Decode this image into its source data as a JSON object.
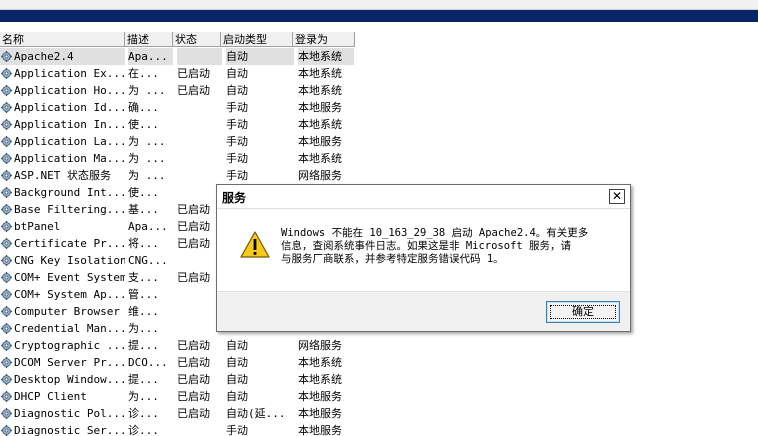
{
  "window": {
    "accent": "#0a246a"
  },
  "columns": {
    "name": "名称",
    "desc": "描述",
    "state": "状态",
    "startup": "启动类型",
    "logon": "登录为"
  },
  "services": [
    {
      "name": "Apache2.4",
      "desc": "Apa...",
      "state": "",
      "startup": "自动",
      "logon": "本地系统"
    },
    {
      "name": "Application Ex...",
      "desc": "在...",
      "state": "已启动",
      "startup": "自动",
      "logon": "本地系统"
    },
    {
      "name": "Application Ho...",
      "desc": "为 ...",
      "state": "已启动",
      "startup": "自动",
      "logon": "本地系统"
    },
    {
      "name": "Application Id...",
      "desc": "确...",
      "state": "",
      "startup": "手动",
      "logon": "本地服务"
    },
    {
      "name": "Application In...",
      "desc": "使...",
      "state": "",
      "startup": "手动",
      "logon": "本地系统"
    },
    {
      "name": "Application La...",
      "desc": "为 ...",
      "state": "",
      "startup": "手动",
      "logon": "本地服务"
    },
    {
      "name": "Application Ma...",
      "desc": "为 ...",
      "state": "",
      "startup": "手动",
      "logon": "本地系统"
    },
    {
      "name": "ASP.NET 状态服务",
      "desc": "为 ...",
      "state": "",
      "startup": "手动",
      "logon": "网络服务"
    },
    {
      "name": "Background Int...",
      "desc": "使...",
      "state": "",
      "startup": "",
      "logon": ""
    },
    {
      "name": "Base Filtering...",
      "desc": "基...",
      "state": "已启动",
      "startup": "",
      "logon": ""
    },
    {
      "name": "btPanel",
      "desc": "Apa...",
      "state": "已启动",
      "startup": "",
      "logon": ""
    },
    {
      "name": "Certificate Pr...",
      "desc": "将...",
      "state": "已启动",
      "startup": "",
      "logon": ""
    },
    {
      "name": "CNG Key Isolation",
      "desc": "CNG...",
      "state": "",
      "startup": "",
      "logon": ""
    },
    {
      "name": "COM+ Event System",
      "desc": "支...",
      "state": "已启动",
      "startup": "",
      "logon": ""
    },
    {
      "name": "COM+ System Ap...",
      "desc": "管...",
      "state": "",
      "startup": "",
      "logon": ""
    },
    {
      "name": "Computer Browser",
      "desc": "维...",
      "state": "",
      "startup": "",
      "logon": ""
    },
    {
      "name": "Credential Man...",
      "desc": "为...",
      "state": "",
      "startup": "",
      "logon": ""
    },
    {
      "name": "Cryptographic ...",
      "desc": "提...",
      "state": "已启动",
      "startup": "自动",
      "logon": "网络服务"
    },
    {
      "name": "DCOM Server Pr...",
      "desc": "DCO...",
      "state": "已启动",
      "startup": "自动",
      "logon": "本地系统"
    },
    {
      "name": "Desktop Window...",
      "desc": "提...",
      "state": "已启动",
      "startup": "自动",
      "logon": "本地系统"
    },
    {
      "name": "DHCP Client",
      "desc": "为...",
      "state": "已启动",
      "startup": "自动",
      "logon": "本地服务"
    },
    {
      "name": "Diagnostic Pol...",
      "desc": "诊...",
      "state": "已启动",
      "startup": "自动(延...",
      "logon": "本地服务"
    },
    {
      "name": "Diagnostic Ser...",
      "desc": "诊...",
      "state": "",
      "startup": "手动",
      "logon": "本地服务"
    }
  ],
  "dialog": {
    "title": "服务",
    "close": "✕",
    "message": "Windows 不能在 10_163_29_38 启动 Apache2.4。有关更多\n信息，查阅系统事件日志。如果这是非 Microsoft 服务，请\n与服务厂商联系，并参考特定服务错误代码 1。",
    "ok_label": "确定",
    "icon": "warning-icon"
  }
}
